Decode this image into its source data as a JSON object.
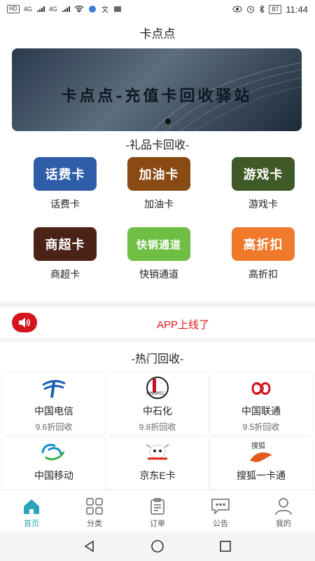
{
  "statusbar": {
    "left_chips": [
      "HD",
      "4G",
      "4G"
    ],
    "battery": "87",
    "time": "11:44"
  },
  "header": {
    "title": "卡点点"
  },
  "banner": {
    "text": "卡点点-充值卡回收驿站"
  },
  "gift_section": {
    "title": "-礼品卡回收-",
    "items": [
      {
        "tile_text": "话费卡",
        "label": "话费卡",
        "color": "#2f5ea8"
      },
      {
        "tile_text": "加油卡",
        "label": "加油卡",
        "color": "#8a4a14"
      },
      {
        "tile_text": "游戏卡",
        "label": "游戏卡",
        "color": "#3f5a26"
      },
      {
        "tile_text": "商超卡",
        "label": "商超卡",
        "color": "#4b2216"
      },
      {
        "tile_text": "快销通道",
        "label": "快销通道",
        "color": "#6fbf45"
      },
      {
        "tile_text": "高折扣",
        "label": "高折扣",
        "color": "#f07a2b"
      }
    ]
  },
  "notice": {
    "text": "APP上线了"
  },
  "hot_section": {
    "title": "-热门回收-",
    "items": [
      {
        "name": "中国电信",
        "rate": "9.6折回收",
        "icon": "china-telecom-icon"
      },
      {
        "name": "中石化",
        "rate": "9.8折回收",
        "icon": "sinopec-icon"
      },
      {
        "name": "中国联通",
        "rate": "9.5折回收",
        "icon": "china-unicom-icon"
      },
      {
        "name": "中国移动",
        "rate": "",
        "icon": "china-mobile-icon"
      },
      {
        "name": "京东E卡",
        "rate": "",
        "icon": "jd-icon"
      },
      {
        "name": "搜狐一卡通",
        "rate": "",
        "icon": "sohu-icon"
      }
    ],
    "sinopec_mark": "SINOPEC",
    "sohu_mark": "搜狐"
  },
  "tabbar": {
    "tabs": [
      {
        "label": "首页",
        "active": true
      },
      {
        "label": "分类",
        "active": false
      },
      {
        "label": "订单",
        "active": false
      },
      {
        "label": "公告",
        "active": false
      },
      {
        "label": "我的",
        "active": false
      }
    ],
    "active_color": "#2aa5b8"
  },
  "colors": {
    "accent": "#2aa5b8",
    "notice_red": "#e0181f"
  }
}
